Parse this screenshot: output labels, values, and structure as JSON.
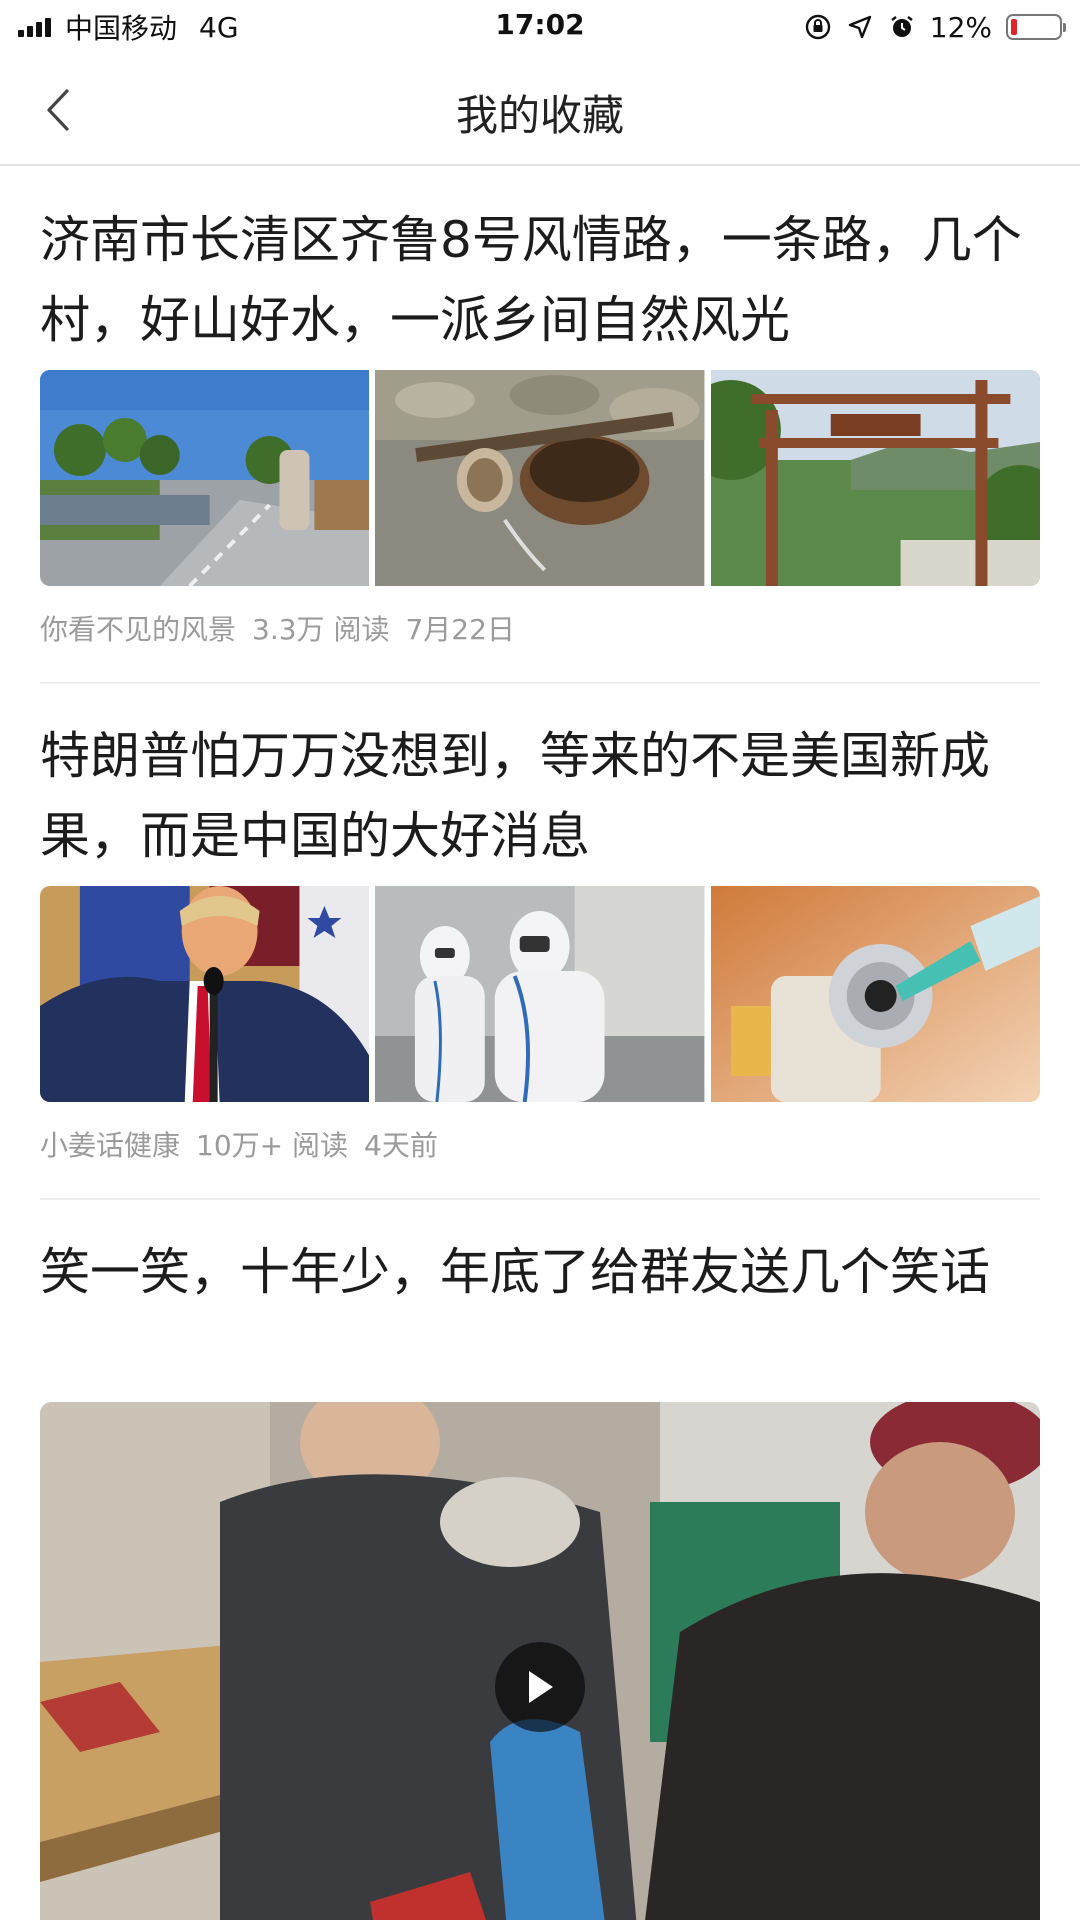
{
  "status_bar": {
    "carrier": "中国移动",
    "network": "4G",
    "time": "17:02",
    "battery_text": "12%",
    "battery_level": 0.12,
    "icons": [
      "signal-icon",
      "orientation-lock-icon",
      "location-icon",
      "alarm-icon",
      "battery-icon"
    ]
  },
  "nav": {
    "title": "我的收藏",
    "back_icon": "chevron-left-icon"
  },
  "articles": [
    {
      "title": "济南市长清区齐鲁8号风情路，一条路，几个村，好山好水，一派乡间自然风光",
      "source": "你看不见的风景",
      "reads": "3.3万 阅读",
      "date": "7月22日"
    },
    {
      "title": "特朗普怕万万没想到，等来的不是美国新成果，而是中国的大好消息",
      "source": "小姜话健康",
      "reads": "10万+ 阅读",
      "date": "4天前"
    },
    {
      "title": "笑一笑，十年少，年底了给群友送几个笑话",
      "media": "video"
    }
  ],
  "colors": {
    "accent_text": "#1c1c1c",
    "meta_text": "#9b9b9b",
    "battery_low": "#e0242c",
    "divider": "#eeeeee"
  }
}
